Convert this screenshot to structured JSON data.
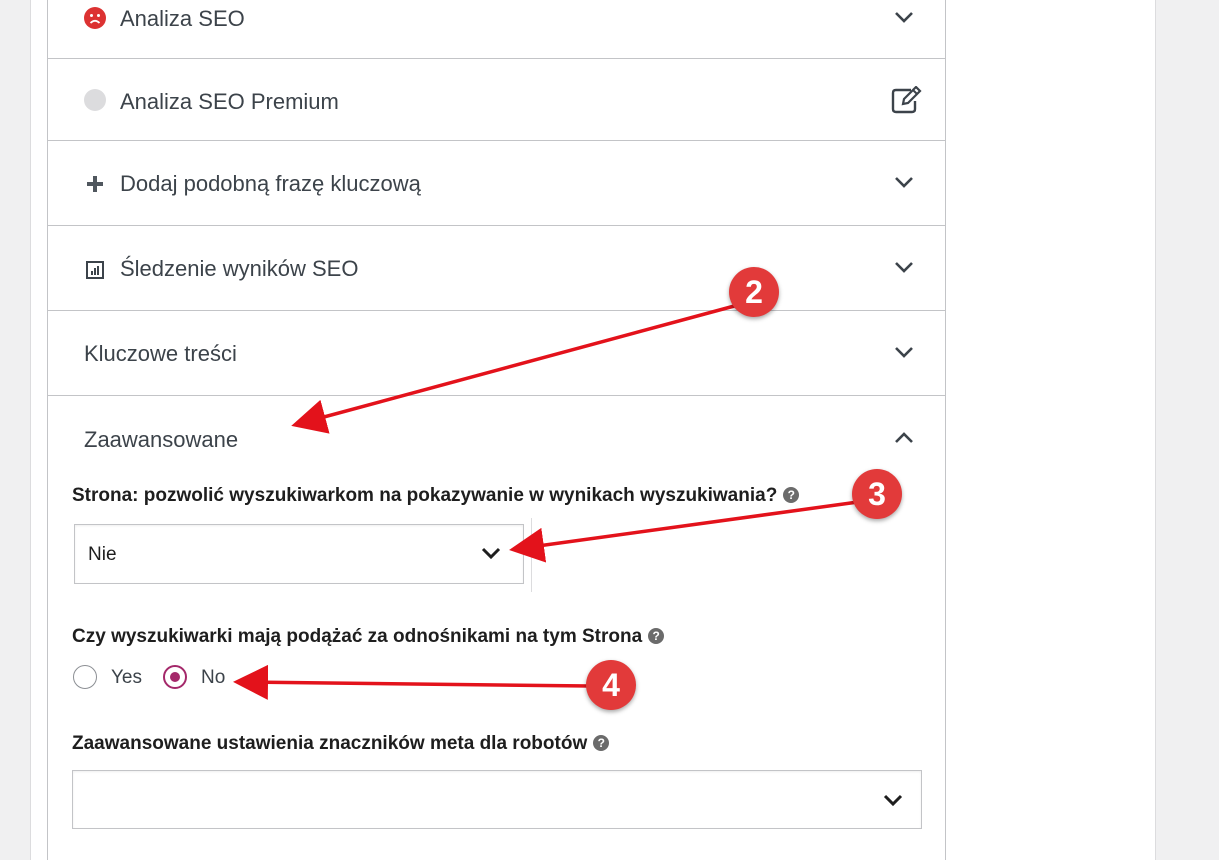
{
  "sections": {
    "seo_analysis": {
      "label": "Analiza SEO",
      "icon": "sad-face-icon",
      "status_color": "#dc3232"
    },
    "premium": {
      "label": "Analiza SEO Premium",
      "icon": "gray-circle-icon"
    },
    "related": {
      "label": "Dodaj podobną frazę kluczową",
      "icon": "plus-icon"
    },
    "tracking": {
      "label": "Śledzenie wyników SEO",
      "icon": "chart-icon"
    },
    "cornerstone": {
      "label": "Kluczowe treści"
    },
    "advanced": {
      "label": "Zaawansowane",
      "expanded": true
    }
  },
  "advanced": {
    "index_question": "Strona: pozwolić wyszukiwarkom na pokazywanie w wynikach wyszukiwania?",
    "index_value": "Nie",
    "follow_question": "Czy wyszukiwarki mają podążać za odnośnikami na tym Strona",
    "follow_options": [
      "Yes",
      "No"
    ],
    "follow_selected": "No",
    "meta_question": "Zaawansowane ustawienia znaczników meta dla robotów",
    "meta_value": ""
  },
  "annotations": [
    "2",
    "3",
    "4"
  ],
  "colors": {
    "accent": "#a4286a",
    "annotation": "#e23a3a",
    "arrow": "#e3121b"
  }
}
